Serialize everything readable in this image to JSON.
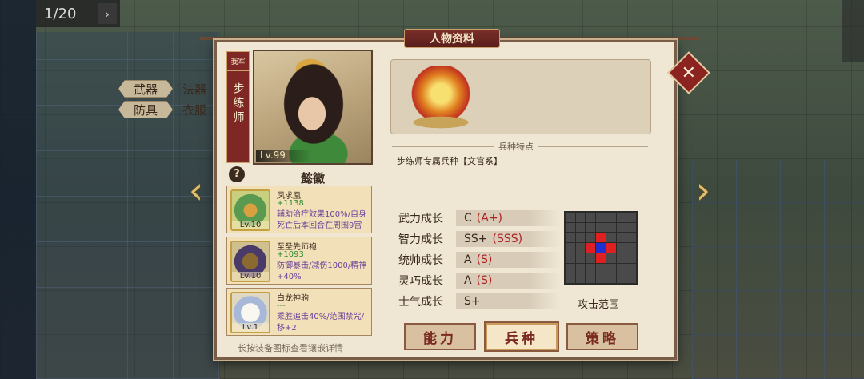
{
  "window": {
    "title": "人物资料"
  },
  "battle": {
    "page_counter": "1/20",
    "next_glyph": "›"
  },
  "hero": {
    "faction_tag": "我军",
    "unit_class": "步练师",
    "level": "Lv.99",
    "name": "懿徽"
  },
  "gear": {
    "weapon_label": "武器",
    "weapon_value": "法器",
    "armor_label": "防具",
    "armor_value": "衣服"
  },
  "traits": {
    "section_title": "兵种特点",
    "text": "步练师专属兵种【文官系】"
  },
  "equipment": [
    {
      "level": "Lv.10",
      "name": "凤求凰",
      "bonus": "+1138",
      "desc": "辅助治疗效果100%/自身死亡后本回合在周围9宫"
    },
    {
      "level": "Lv.10",
      "name": "至圣先师袍",
      "bonus": "+1093",
      "desc": "防御暴击/减伤1000/精神+40%"
    },
    {
      "level": "Lv.1",
      "name": "白龙神驹",
      "bonus": "---",
      "desc": "乘胜追击40%/范围禁咒/移+2"
    }
  ],
  "equip_hint": "长按装备图标查看镶嵌详情",
  "stats": [
    {
      "label": "武力成长",
      "grade": "C",
      "potential": "(A+)"
    },
    {
      "label": "智力成长",
      "grade": "SS+",
      "potential": "(SSS)"
    },
    {
      "label": "统帅成长",
      "grade": "A",
      "potential": "(S)"
    },
    {
      "label": "灵巧成长",
      "grade": "A",
      "potential": "(S)"
    },
    {
      "label": "士气成长",
      "grade": "S+",
      "potential": ""
    }
  ],
  "attack_range": {
    "label": "攻击范围",
    "grid_size": 7,
    "attack_cells": [
      [
        2,
        3
      ],
      [
        3,
        2
      ],
      [
        3,
        4
      ],
      [
        4,
        3
      ]
    ],
    "self_cell": [
      3,
      3
    ]
  },
  "tabs": [
    {
      "label": "能力",
      "active": false
    },
    {
      "label": "兵种",
      "active": true
    },
    {
      "label": "策略",
      "active": false
    }
  ],
  "icons": {
    "close": "close-icon",
    "prev": "chevron-left-icon",
    "next": "chevron-right-icon",
    "help": "question-icon"
  },
  "colors": {
    "title_bar": "#7a2f2a",
    "attack_cell": "#e02020",
    "self_cell": "#2030d0",
    "potential_text": "#b02020",
    "bonus_text": "#2e8a2e"
  }
}
